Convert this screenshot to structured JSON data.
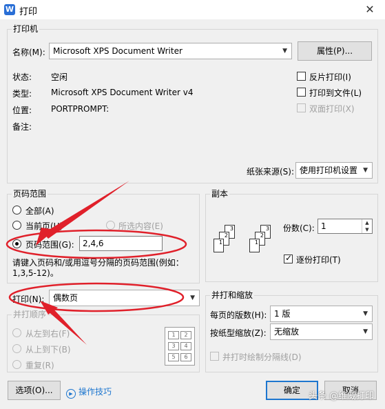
{
  "window": {
    "app_icon": "W",
    "title": "打印",
    "close": "✕"
  },
  "printer": {
    "group_label": "打印机",
    "name_label": "名称(M):",
    "name_value": "Microsoft XPS Document Writer",
    "properties_button": "属性(P)...",
    "status_label": "状态:",
    "status_value": "空闲",
    "type_label": "类型:",
    "type_value": "Microsoft XPS Document Writer v4",
    "location_label": "位置:",
    "location_value": "PORTPROMPT:",
    "comment_label": "备注:",
    "reverse_print": "反片打印(I)",
    "print_to_file": "打印到文件(L)",
    "duplex": "双面打印(X)",
    "paper_source_label": "纸张来源(S):",
    "paper_source_value": "使用打印机设置"
  },
  "page_range": {
    "group_label": "页码范围",
    "all": "全部(A)",
    "current": "当前页(U)",
    "selection": "所选内容(E)",
    "range": "页码范围(G):",
    "range_value": "2,4,6",
    "hint": "请键入页码和/或用逗号分隔的页码范围(例如：1,3,5-12)。",
    "print_label": "打印(N):",
    "print_value": "偶数页"
  },
  "print_order": {
    "group_label": "并打顺序",
    "left_right": "从左到右(F)",
    "top_bottom": "从上到下(B)",
    "repeat": "重复(R)",
    "grid": [
      "1",
      "2",
      "3",
      "4",
      "5",
      "6"
    ]
  },
  "copies": {
    "group_label": "副本",
    "copies_label": "份数(C):",
    "copies_value": "1",
    "collate": "逐份打印(T)",
    "page_numbers": [
      "1",
      "2",
      "3"
    ]
  },
  "zoom": {
    "group_label": "并打和缩放",
    "pages_per_sheet_label": "每页的版数(H):",
    "pages_per_sheet_value": "1 版",
    "scale_label": "按纸型缩放(Z):",
    "scale_value": "无缩放",
    "draw_borders": "并打时绘制分隔线(D)"
  },
  "footer": {
    "options_button": "选项(O)...",
    "tips_link": "操作技巧",
    "ok_button": "确定",
    "cancel_button": "取消",
    "watermark": "头条 @维威打印"
  },
  "colors": {
    "annotation": "#e0202a",
    "accent": "#1d76cf"
  }
}
